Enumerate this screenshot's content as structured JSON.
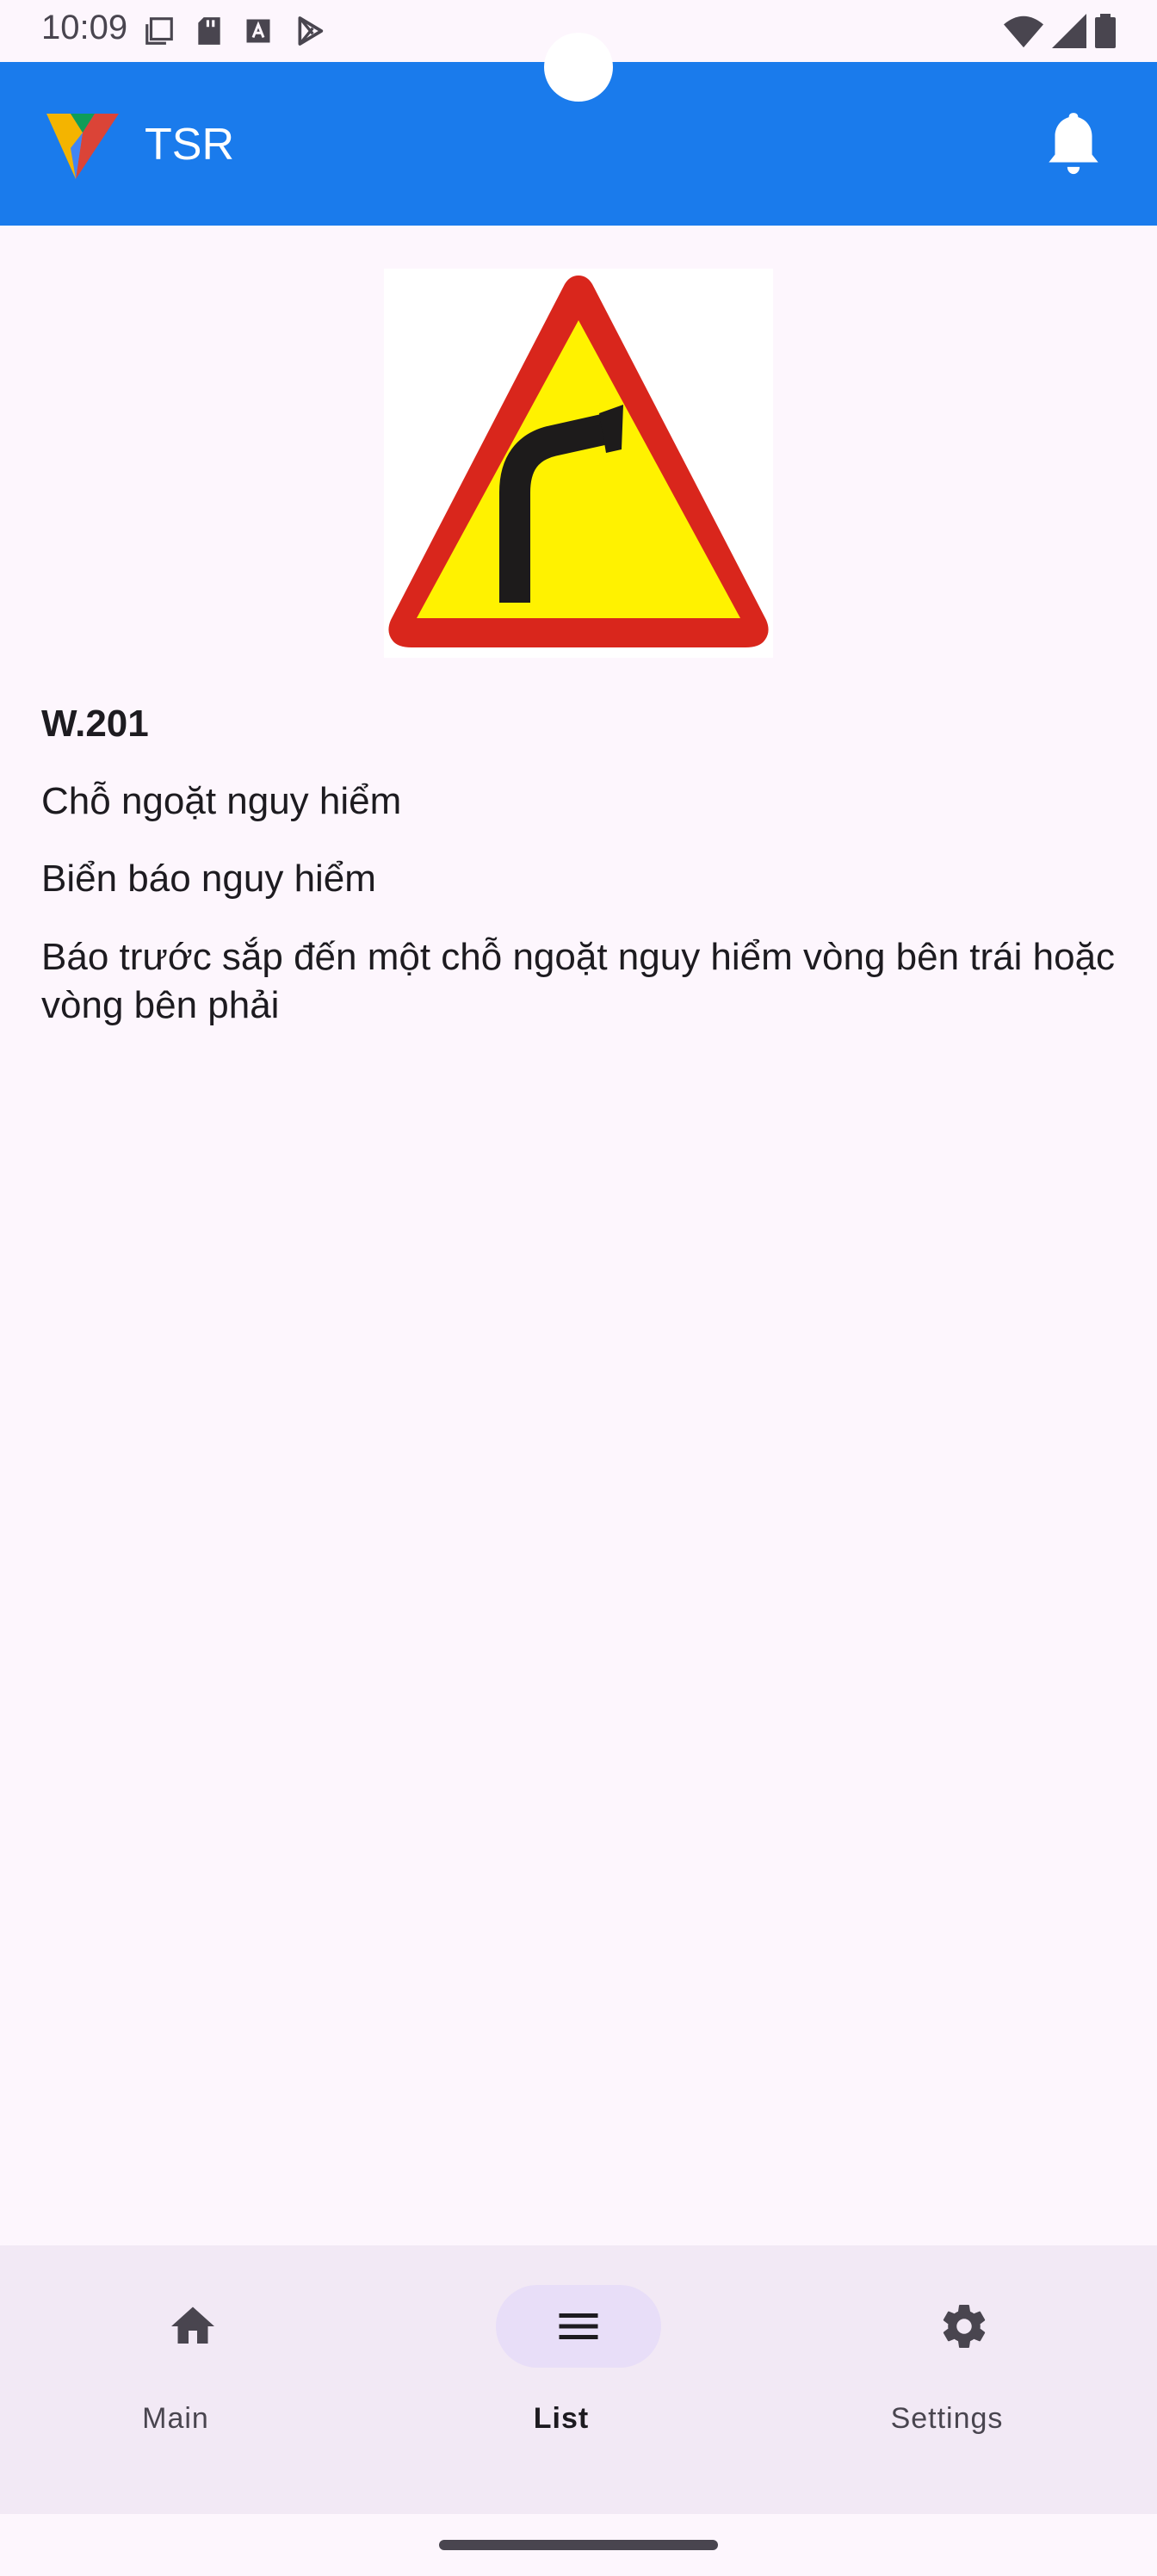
{
  "status_bar": {
    "time": "10:09",
    "left_icons": [
      "screenshot-icon",
      "sd-card-icon",
      "text-a-icon",
      "play-store-icon"
    ],
    "right_icons": [
      "wifi-icon",
      "cellular-signal-icon",
      "battery-icon"
    ]
  },
  "app_bar": {
    "title": "TSR",
    "logo_icon": "tsr-logo-icon",
    "action_icon": "bell-icon",
    "color": "#1a7bec"
  },
  "sign": {
    "image_icon": "dangerous-curve-right-sign",
    "code": "W.201",
    "name": "Chỗ ngoặt nguy hiểm",
    "category": "Biển báo nguy hiểm",
    "description": "Báo trước sắp đến một chỗ ngoặt nguy hiểm vòng bên trái hoặc vòng bên phải"
  },
  "bottom_nav": {
    "items": [
      {
        "label": "Main",
        "icon": "home-icon",
        "active": false
      },
      {
        "label": "List",
        "icon": "list-icon",
        "active": true
      },
      {
        "label": "Settings",
        "icon": "gear-icon",
        "active": false
      }
    ]
  },
  "colors": {
    "background": "#fdf6fd",
    "nav_background": "#f2e9f5",
    "active_indicator": "#e8def8",
    "sign_red": "#d9261c",
    "sign_yellow": "#fff200"
  }
}
